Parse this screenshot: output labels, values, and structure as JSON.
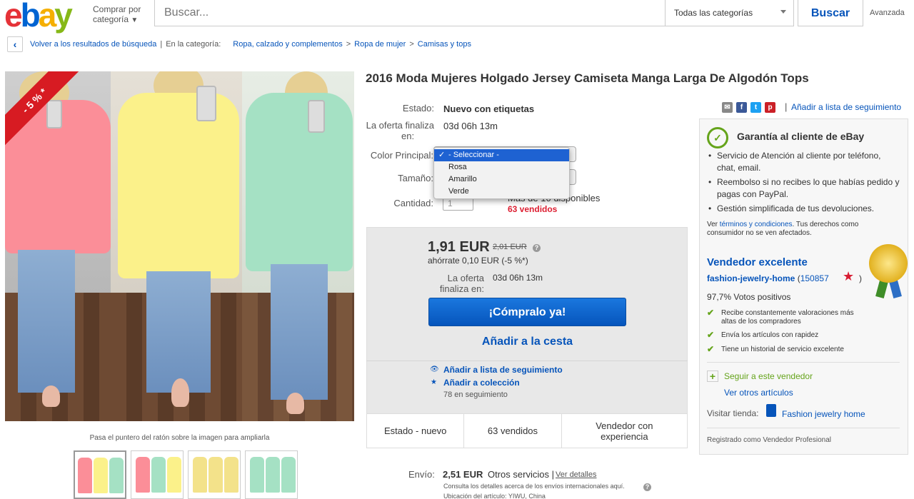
{
  "header": {
    "logo": [
      "e",
      "b",
      "a",
      "y"
    ],
    "shop_by": "Comprar por",
    "shop_by2": "categoría",
    "search_placeholder": "Buscar...",
    "category_select": "Todas las categorías",
    "search_button": "Buscar",
    "advanced": "Avanzada"
  },
  "breadcrumb": {
    "back": "Volver a los resultados de búsqueda",
    "in_category": "En la categoría:",
    "items": [
      "Ropa, calzado y complementos",
      "Ropa de mujer",
      "Camisas y tops"
    ],
    "sep": ">"
  },
  "image": {
    "discount_badge": "- 5 % *",
    "zoom_hint": "Pasa el puntero del ratón sobre la imagen para ampliarla"
  },
  "product": {
    "title": "2016 Moda Mujeres Holgado Jersey Camiseta Manga Larga De Algodón Tops",
    "condition_label": "Estado:",
    "condition_value": "Nuevo con etiquetas",
    "ends_label": "La oferta finaliza",
    "ends_label2": "en:",
    "ends_value": "03d 06h 13m",
    "color_label": "Color Principal:",
    "size_label": "Tamaño:",
    "qty_label": "Cantidad:",
    "qty_value": "1",
    "available": "Más de 10 disponibles",
    "sold": "63 vendidos"
  },
  "color_dropdown": {
    "options": [
      "- Seleccionar -",
      "Rosa",
      "Amarillo",
      "Verde"
    ],
    "selected_index": 0
  },
  "buybox": {
    "price": "1,91 EUR",
    "old_price": "2,01 EUR",
    "info_glyph": "?",
    "savings": "ahórrate 0,10 EUR (-5 %*)",
    "ends_label": "La oferta",
    "ends_label2": "finaliza en:",
    "ends_value": "03d 06h 13m",
    "buy_now": "¡Cómpralo ya!",
    "add_cart": "Añadir a la cesta",
    "add_watch": "Añadir a lista de seguimiento",
    "add_collection": "Añadir a colección",
    "watching": "78 en seguimiento",
    "stats": [
      "Estado - nuevo",
      "63 vendidos",
      "Vendedor con experiencia"
    ]
  },
  "shipping": {
    "label": "Envío:",
    "price": "2,51 EUR",
    "service": "Otros servicios",
    "details_link": "Ver detalles",
    "note": "Consulta los detalles acerca de los envíos internacionales aquí.",
    "location": "Ubicación del artículo: YIWU, China"
  },
  "share": {
    "watch_link": "Añadir a lista de seguimiento",
    "separator": "|"
  },
  "guarantee": {
    "title": "Garantía al cliente de eBay",
    "items": [
      "Servicio de Atención al cliente por teléfono, chat, email.",
      "Reembolso si no recibes lo que habías pedido y pagas con PayPal.",
      "Gestión simplificada de tus devoluciones."
    ],
    "note_pre": "Ver",
    "note_link": "términos y condiciones",
    "note_post": ". Tus derechos como consumidor no se ven afectados."
  },
  "seller": {
    "badge": "Vendedor excelente",
    "name": "fashion-jewelry-home",
    "feedback_open": "(",
    "feedback": "150857",
    "feedback_close": ")",
    "positive": "97,7% Votos positivos",
    "checks": [
      "Recibe constantemente valoraciones más altas de los compradores",
      "Envía los artículos con rapidez",
      "Tiene un historial de servicio excelente"
    ],
    "follow": "Seguir a este vendedor",
    "other_items": "Ver otros artículos",
    "visit_store": "Visitar tienda:",
    "store_name": "Fashion jewelry home",
    "registered": "Registrado como Vendedor Profesional"
  }
}
